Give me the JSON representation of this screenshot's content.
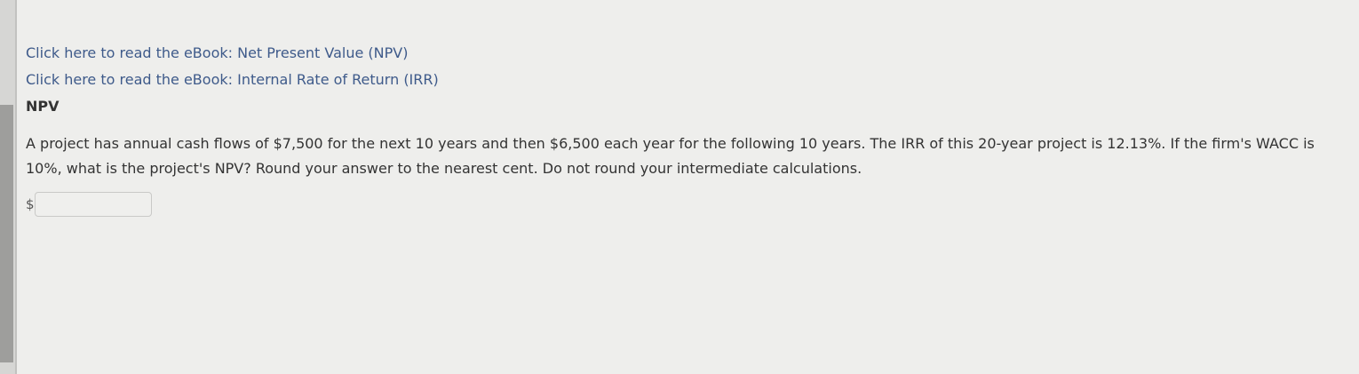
{
  "links": {
    "npv_ebook": "Click here to read the eBook: Net Present Value (NPV)",
    "irr_ebook": "Click here to read the eBook: Internal Rate of Return (IRR)"
  },
  "section": {
    "heading": "NPV"
  },
  "question": {
    "text": "A project has annual cash flows of $7,500 for the next 10 years and then $6,500 each year for the following 10 years. The IRR of this 20-year project is 12.13%. If the firm's WACC is 10%, what is the project's NPV? Round your answer to the nearest cent. Do not round your intermediate calculations."
  },
  "answer": {
    "currency": "$",
    "value": ""
  }
}
